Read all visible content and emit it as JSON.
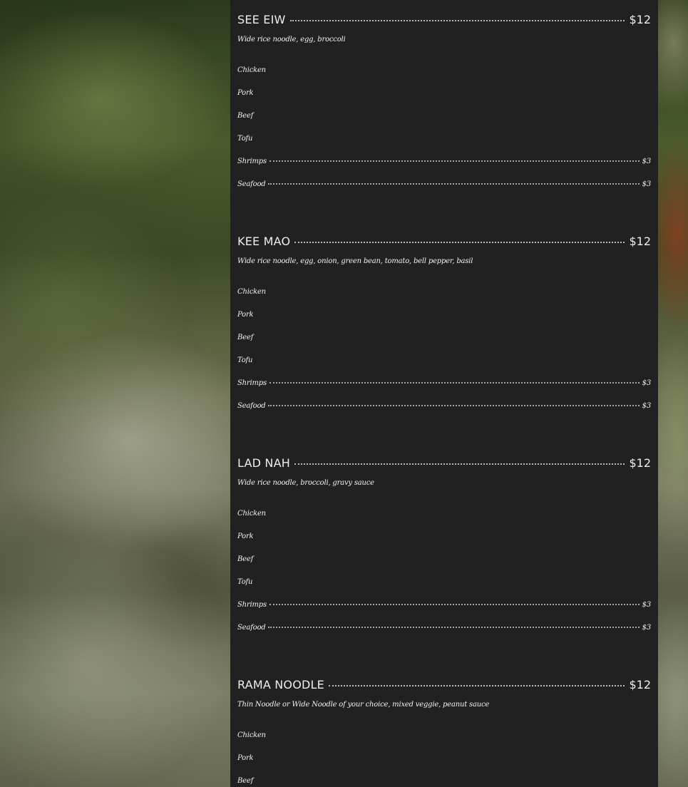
{
  "menu": {
    "dishes": [
      {
        "name": "SEE EIW",
        "price": "$12",
        "description": "Wide rice noodle, egg, broccoli",
        "options": [
          {
            "label": "Chicken",
            "price": ""
          },
          {
            "label": "Pork",
            "price": ""
          },
          {
            "label": "Beef",
            "price": ""
          },
          {
            "label": "Tofu",
            "price": ""
          },
          {
            "label": "Shrimps",
            "price": "$3"
          },
          {
            "label": "Seafood",
            "price": "$3"
          }
        ]
      },
      {
        "name": "KEE MAO",
        "price": "$12",
        "description": "Wide rice noodle, egg, onion, green bean, tomato, bell pepper, basil",
        "options": [
          {
            "label": "Chicken",
            "price": ""
          },
          {
            "label": "Pork",
            "price": ""
          },
          {
            "label": "Beef",
            "price": ""
          },
          {
            "label": "Tofu",
            "price": ""
          },
          {
            "label": "Shrimps",
            "price": "$3"
          },
          {
            "label": "Seafood",
            "price": "$3"
          }
        ]
      },
      {
        "name": "LAD NAH",
        "price": "$12",
        "description": "Wide rice noodle, broccoli, gravy sauce",
        "options": [
          {
            "label": "Chicken",
            "price": ""
          },
          {
            "label": "Pork",
            "price": ""
          },
          {
            "label": "Beef",
            "price": ""
          },
          {
            "label": "Tofu",
            "price": ""
          },
          {
            "label": "Shrimps",
            "price": "$3"
          },
          {
            "label": "Seafood",
            "price": "$3"
          }
        ]
      },
      {
        "name": "RAMA NOODLE",
        "price": "$12",
        "description": "Thin Noodle or Wide Noodle of your choice, mixed veggie, peanut sauce",
        "options": [
          {
            "label": "Chicken",
            "price": ""
          },
          {
            "label": "Pork",
            "price": ""
          },
          {
            "label": "Beef",
            "price": ""
          }
        ]
      }
    ]
  }
}
